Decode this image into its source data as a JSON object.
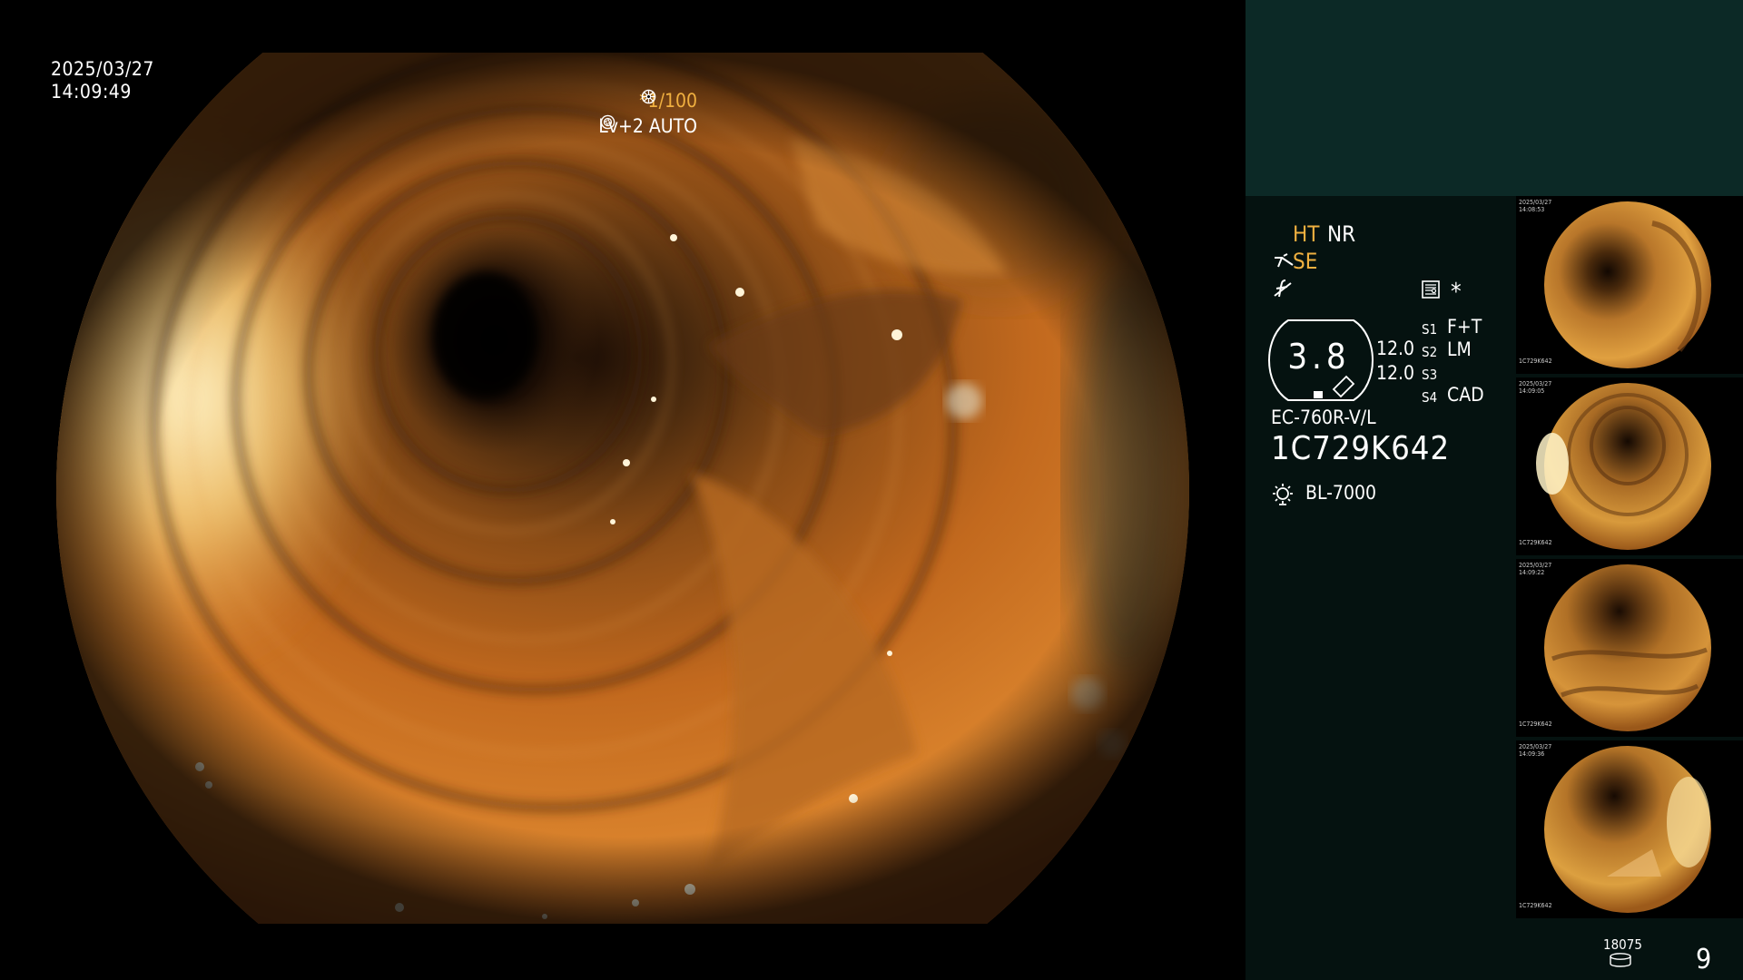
{
  "overlay": {
    "date": "2025/03/27",
    "time": "14:09:49",
    "shutter": "*1/100",
    "light_mode": "Lv+2 AUTO"
  },
  "status": {
    "ht": "HT",
    "nr": "NR",
    "se": "SE",
    "memo_star": "*",
    "gauge_value": "3.8",
    "gauge_values": [
      "12.0",
      "12.0"
    ],
    "switches": [
      {
        "name": "S1",
        "value": "F+T"
      },
      {
        "name": "S2",
        "value": "LM"
      },
      {
        "name": "S3",
        "value": ""
      },
      {
        "name": "S4",
        "value": "CAD"
      }
    ],
    "scope_model": "EC-760R-V/L",
    "scope_serial": "1C729K642",
    "light_source": "BL-7000"
  },
  "thumbnails": [
    {
      "date": "2025/03/27",
      "time": "14:08:53",
      "serial": "1C729K642"
    },
    {
      "date": "2025/03/27",
      "time": "14:09:05",
      "serial": "1C729K642"
    },
    {
      "date": "2025/03/27",
      "time": "14:09:22",
      "serial": "1C729K642"
    },
    {
      "date": "2025/03/27",
      "time": "14:09:36",
      "serial": "1C729K642"
    }
  ],
  "footer": {
    "image_counter": "18075",
    "page_number": "9"
  },
  "colors": {
    "accent_yellow": "#f0b040",
    "sidebar_top": "#0c2926",
    "sidebar_bg": "#051210"
  },
  "icons": [
    "shutter-wheel-icon",
    "auto-iris-icon",
    "structure-enhance-icon",
    "freeze-icon",
    "memo-icon",
    "brightness-gauge-icon",
    "light-source-bulb-icon",
    "storage-disk-icon"
  ]
}
